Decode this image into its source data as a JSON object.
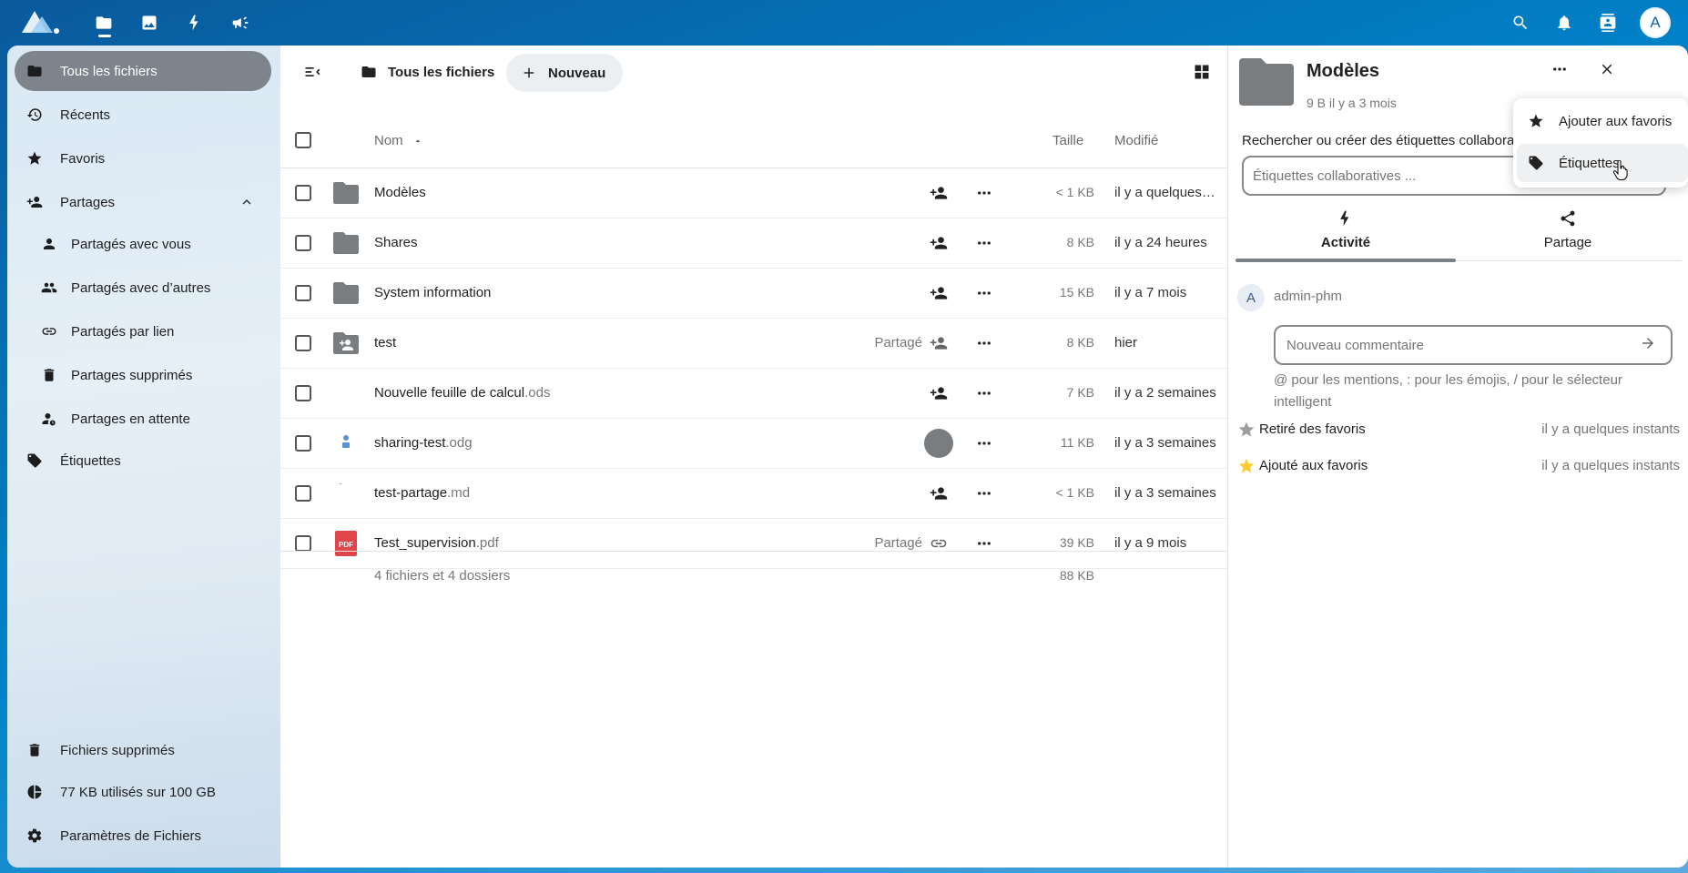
{
  "header": {
    "apps": [
      "files-icon",
      "photos-icon",
      "activity-icon",
      "announcements-icon"
    ],
    "avatar_letter": "A"
  },
  "nav": {
    "items": [
      {
        "label": "Tous les fichiers",
        "icon": "folder-icon"
      },
      {
        "label": "Récents",
        "icon": "history-icon"
      },
      {
        "label": "Favoris",
        "icon": "star-icon"
      },
      {
        "label": "Partages",
        "icon": "share-icon"
      },
      {
        "label": "Partagés avec vous",
        "icon": "account-icon"
      },
      {
        "label": "Partagés avec d’autres",
        "icon": "group-icon"
      },
      {
        "label": "Partagés par lien",
        "icon": "link-icon"
      },
      {
        "label": "Partages supprimés",
        "icon": "trash-icon"
      },
      {
        "label": "Partages en attente",
        "icon": "account-clock-icon"
      },
      {
        "label": "Étiquettes",
        "icon": "tags-icon"
      }
    ],
    "footer": {
      "trash": "Fichiers supprimés",
      "quota": "77 KB utilisés sur 100 GB",
      "settings": "Paramètres de Fichiers"
    }
  },
  "toolbar": {
    "breadcrumb": "Tous les fichiers",
    "new_label": "Nouveau"
  },
  "list": {
    "headers": {
      "name": "Nom",
      "size": "Taille",
      "modified": "Modifié"
    },
    "rows": [
      {
        "name": "Modèles",
        "ext": "",
        "shared": "",
        "size": "< 1 KB",
        "modified": "il y a quelques…"
      },
      {
        "name": "Shares",
        "ext": "",
        "shared": "",
        "size": "8 KB",
        "modified": "il y a 24 heures"
      },
      {
        "name": "System information",
        "ext": "",
        "shared": "",
        "size": "15 KB",
        "modified": "il y a 7 mois"
      },
      {
        "name": "test",
        "ext": "",
        "shared": "Partagé",
        "size": "8 KB",
        "modified": "hier"
      },
      {
        "name": "Nouvelle feuille de calcul",
        "ext": ".ods",
        "shared": "",
        "size": "7 KB",
        "modified": "il y a 2 semaines"
      },
      {
        "name": "sharing-test",
        "ext": ".odg",
        "shared": "",
        "size": "11 KB",
        "modified": "il y a 3 semaines"
      },
      {
        "name": "test-partage",
        "ext": ".md",
        "shared": "",
        "size": "< 1 KB",
        "modified": "il y a 3 semaines"
      },
      {
        "name": "Test_supervision",
        "ext": ".pdf",
        "shared": "Partagé",
        "size": "39 KB",
        "modified": "il y a 9 mois"
      }
    ],
    "footer": {
      "summary": "4 fichiers et 4 dossiers",
      "total": "88 KB"
    }
  },
  "sidebar": {
    "title": "Modèles",
    "subtitle": "9 B il y a 3 mois",
    "tags_label": "Rechercher ou créer des étiquettes collaboratives",
    "tags_placeholder": "Étiquettes collaboratives ...",
    "tabs": [
      "Activité",
      "Partage"
    ],
    "activity": {
      "avatar_letter": "A",
      "user": "admin-phm",
      "comment_placeholder": "Nouveau commentaire",
      "hint": "@ pour les mentions, : pour les émojis, / pour le sélecteur intelligent",
      "events": [
        {
          "text": "Retiré des favoris",
          "when": "il y a quelques instants",
          "star_color": "#9e9e9e"
        },
        {
          "text": "Ajouté aux favoris",
          "when": "il y a quelques instants",
          "star_color": "#ffcc33"
        }
      ]
    }
  },
  "popup": {
    "items": [
      {
        "label": "Ajouter aux favoris",
        "icon": "star-icon"
      },
      {
        "label": "Étiquettes",
        "icon": "tag-icon"
      }
    ]
  },
  "colors": {
    "header_bg": "#0082c9",
    "active_nav": "#7d848b",
    "folder": "#7a7d80",
    "pdf": "#e0454a"
  }
}
